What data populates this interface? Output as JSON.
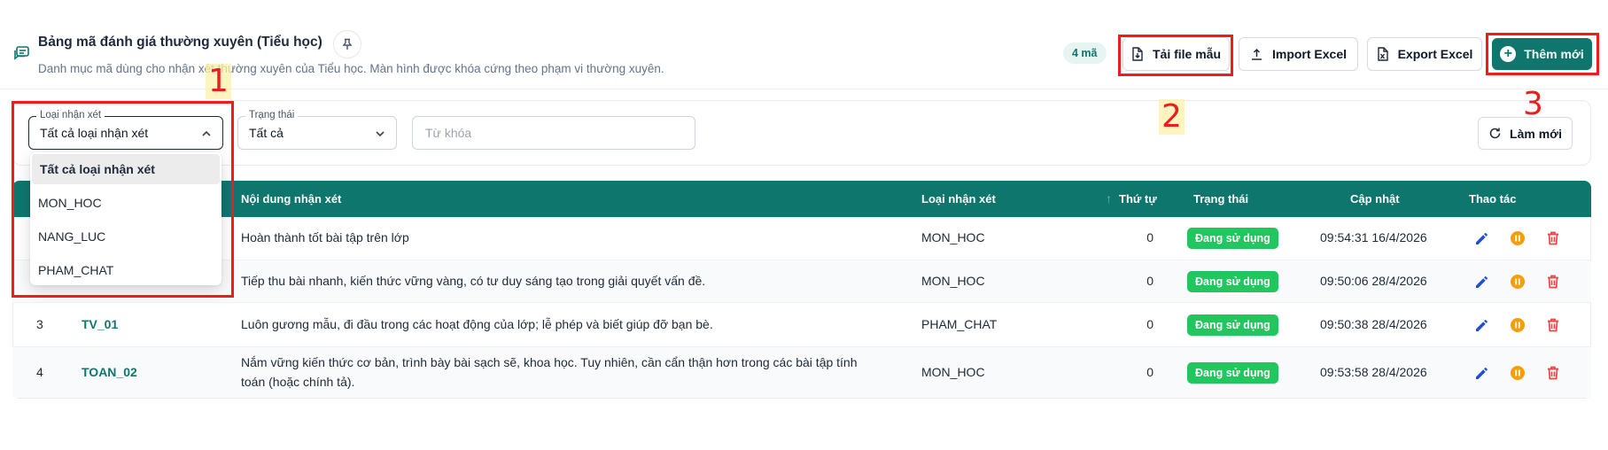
{
  "header": {
    "title": "Bảng mã đánh giá thường xuyên (Tiểu học)",
    "subtitle": "Danh mục mã dùng cho nhận xét thường xuyên của Tiểu học. Màn hình được khóa cứng theo phạm vi thường xuyên.",
    "count_badge": "4 mã"
  },
  "toolbar": {
    "download_template": "Tải file mẫu",
    "import_excel": "Import Excel",
    "export_excel": "Export Excel",
    "add_new": "Thêm mới"
  },
  "filters": {
    "type_label": "Loại nhận xét",
    "type_value": "Tất cả loại nhận xét",
    "status_label": "Trạng thái",
    "status_value": "Tất cả",
    "keyword_placeholder": "Từ khóa",
    "refresh": "Làm mới"
  },
  "dropdown": {
    "options": [
      "Tất cả loại nhận xét",
      "MON_HOC",
      "NANG_LUC",
      "PHAM_CHAT"
    ],
    "selected_index": 0
  },
  "table": {
    "columns": {
      "content": "Nội dung nhận xét",
      "type": "Loại nhận xét",
      "order": "Thứ tự",
      "status": "Trạng thái",
      "updated": "Cập nhật",
      "actions": "Thao tác"
    },
    "rows": [
      {
        "index": "",
        "code": "",
        "content": "Hoàn thành tốt bài tập trên lớp",
        "type": "MON_HOC",
        "order": "0",
        "status": "Đang sử dụng",
        "updated": "09:54:31 16/4/2026"
      },
      {
        "index": "",
        "code": "",
        "content": "Tiếp thu bài nhanh, kiến thức vững vàng, có tư duy sáng tạo trong giải quyết vấn đề.",
        "type": "MON_HOC",
        "order": "0",
        "status": "Đang sử dụng",
        "updated": "09:50:06 28/4/2026"
      },
      {
        "index": "3",
        "code": "TV_01",
        "content": "Luôn gương mẫu, đi đầu trong các hoạt động của lớp; lễ phép và biết giúp đỡ bạn bè.",
        "type": "PHAM_CHAT",
        "order": "0",
        "status": "Đang sử dụng",
        "updated": "09:50:38 28/4/2026"
      },
      {
        "index": "4",
        "code": "TOAN_02",
        "content": "Nắm vững kiến thức cơ bản, trình bày bài sạch sẽ, khoa học. Tuy nhiên, cần cẩn thận hơn trong các bài tập tính toán (hoặc chính tả).",
        "type": "MON_HOC",
        "order": "0",
        "status": "Đang sử dụng",
        "updated": "09:53:58 28/4/2026"
      }
    ]
  },
  "annotations": {
    "one": "1",
    "two": "2",
    "three": "3",
    "color": "#ee1c1c"
  },
  "colors": {
    "brand": "#0f766e",
    "status_active": "#22c55e",
    "edit_icon": "#1d4ed8",
    "pause_icon": "#f59e0b",
    "delete_icon": "#ef4444"
  },
  "icons": {
    "header": "comments-icon",
    "pin": "pin-icon",
    "template": "file-download-icon",
    "import": "upload-icon",
    "export": "excel-icon",
    "add": "plus-circle-icon",
    "refresh": "refresh-icon",
    "row_actions": [
      "edit-icon",
      "pause-icon",
      "delete-icon"
    ]
  }
}
